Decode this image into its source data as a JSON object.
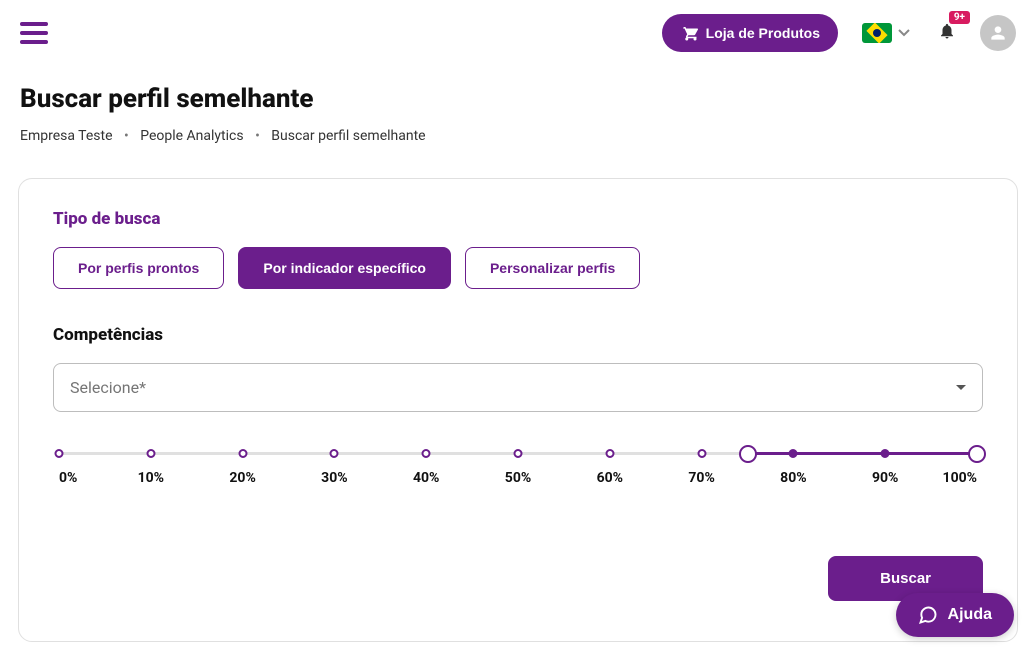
{
  "header": {
    "store_button": "Loja de Produtos",
    "notification_badge": "9+"
  },
  "page": {
    "title": "Buscar perfil semelhante"
  },
  "breadcrumb": {
    "items": [
      "Empresa Teste",
      "People Analytics",
      "Buscar perfil semelhante"
    ]
  },
  "card": {
    "search_type_label": "Tipo de busca",
    "tabs": [
      {
        "label": "Por perfis prontos",
        "active": false
      },
      {
        "label": "Por indicador específico",
        "active": true
      },
      {
        "label": "Personalizar perfis",
        "active": false
      }
    ],
    "competencies_label": "Competências",
    "select_placeholder": "Selecione*",
    "slider": {
      "ticks": [
        "0%",
        "10%",
        "20%",
        "30%",
        "40%",
        "50%",
        "60%",
        "70%",
        "80%",
        "90%",
        "100%"
      ],
      "range_start_index": 7.5,
      "range_end_index": 10
    },
    "search_button": "Buscar"
  },
  "help": {
    "label": "Ajuda"
  }
}
